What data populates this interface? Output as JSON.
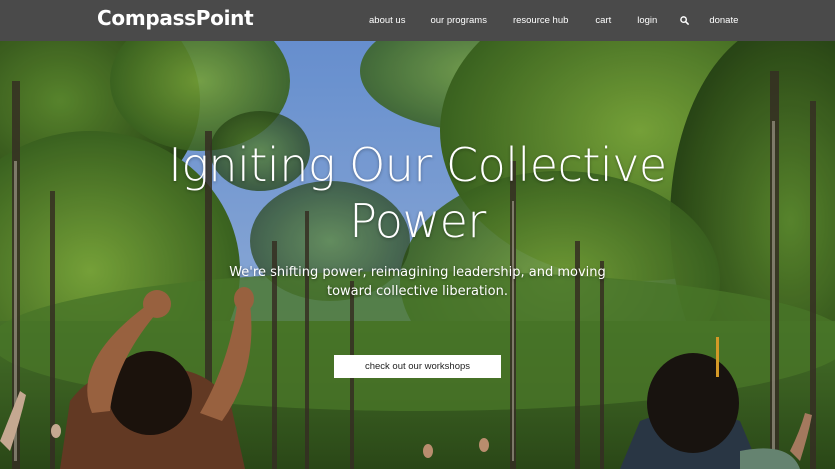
{
  "nav": {
    "logo": "CompassPoint",
    "links": [
      "about us",
      "our programs",
      "resource hub",
      "cart",
      "login",
      "donate"
    ],
    "search_icon": "search-icon"
  },
  "hero": {
    "title_line1": "Igniting Our Collective",
    "title_line2": "Power",
    "subtitle_line1": "We're shifting power, reimagining leadership, and moving",
    "subtitle_line2": "toward collective liberation.",
    "cta_label": "check out our workshops"
  },
  "colors": {
    "navbar_bg": "#4a4a4a",
    "text": "#ffffff",
    "button_bg": "#ffffff",
    "button_text": "#222222",
    "sky": "#7aa6e0",
    "foliage": "#3f6a25"
  }
}
